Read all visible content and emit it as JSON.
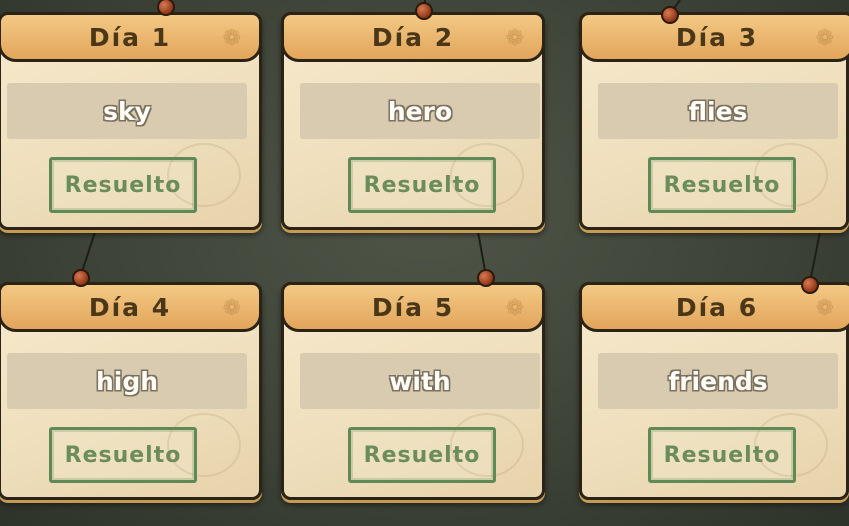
{
  "cards": [
    {
      "title": "Día 1",
      "word": "sky",
      "status": "Resuelto"
    },
    {
      "title": "Día 2",
      "word": "hero",
      "status": "Resuelto"
    },
    {
      "title": "Día 3",
      "word": "flies",
      "status": "Resuelto"
    },
    {
      "title": "Día 4",
      "word": "high",
      "status": "Resuelto"
    },
    {
      "title": "Día 5",
      "word": "with",
      "status": "Resuelto"
    },
    {
      "title": "Día 6",
      "word": "friends",
      "status": "Resuelto"
    }
  ],
  "icons": {
    "header_decoration": "paw-print-icon",
    "pin": "push-pin-icon"
  },
  "colors": {
    "header": "#e9b36c",
    "card": "#f1e2c2",
    "stamp": "#6b8d5b",
    "board": "#454b3e",
    "pin": "#b5502b"
  }
}
